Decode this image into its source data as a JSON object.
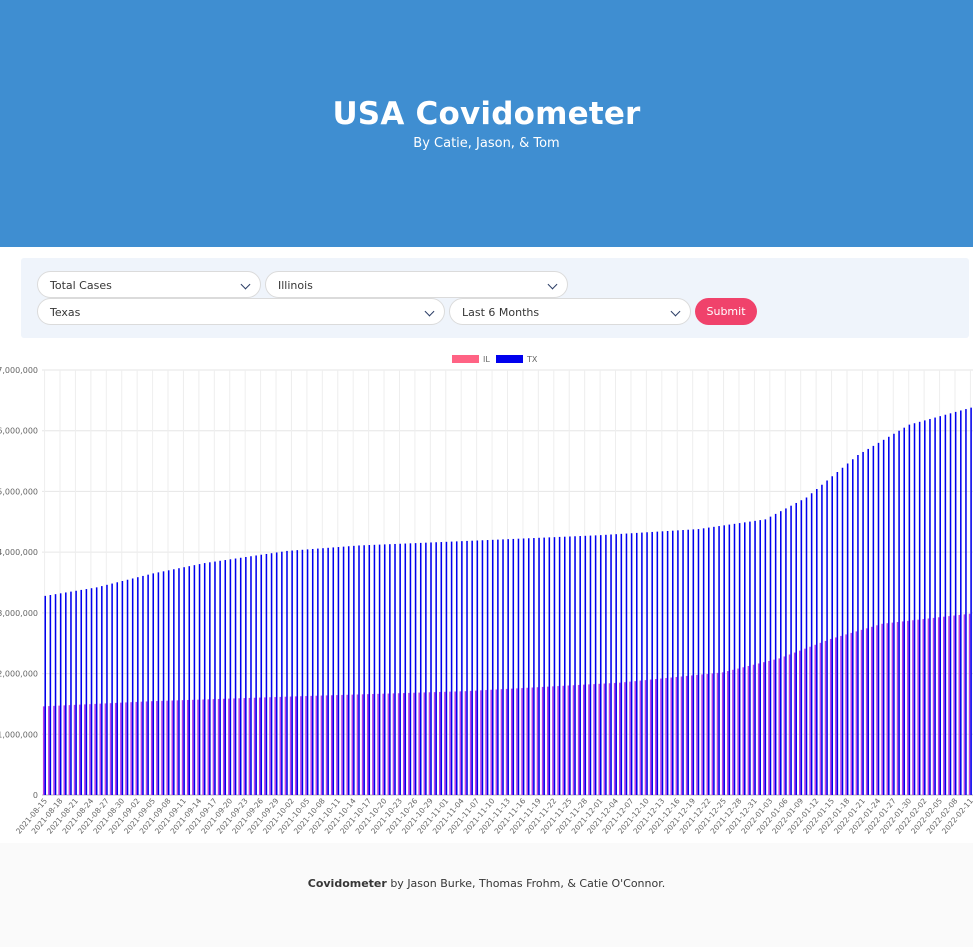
{
  "hero": {
    "title": "USA Covidometer",
    "subtitle": "By Catie, Jason, & Tom"
  },
  "controls": {
    "metric_select": "Total Cases",
    "state1_select": "Illinois",
    "state2_select": "Texas",
    "range_select": "Last 6 Months",
    "submit_label": "Submit"
  },
  "colors": {
    "hero_bg": "#3f8ed1",
    "controls_bg": "#eff4fb",
    "submit_bg": "#f0426b",
    "il_legend": "#ff6384",
    "il_bar": "#b93fe5",
    "tx_bar": "#0000ee"
  },
  "chart_data": {
    "type": "bar",
    "start_date": "2021-08-15",
    "end_date": "2022-02-11",
    "ylim": [
      0,
      7000000
    ],
    "yticks": [
      "0",
      "1,000,000",
      "2,000,000",
      "3,000,000",
      "4,000,000",
      "5,000,000",
      "6,000,000",
      "7,000,000"
    ],
    "legend_position": "top",
    "grid": true,
    "series": [
      {
        "name": "IL",
        "knots": [
          [
            "2021-08-15",
            1460000
          ],
          [
            "2021-09-05",
            1545000
          ],
          [
            "2021-10-05",
            1630000
          ],
          [
            "2021-11-05",
            1710000
          ],
          [
            "2021-12-05",
            1850000
          ],
          [
            "2021-12-25",
            2020000
          ],
          [
            "2022-01-05",
            2250000
          ],
          [
            "2022-01-15",
            2570000
          ],
          [
            "2022-01-25",
            2820000
          ],
          [
            "2022-02-11",
            2985000
          ]
        ]
      },
      {
        "name": "TX",
        "knots": [
          [
            "2021-08-15",
            3280000
          ],
          [
            "2021-08-25",
            3420000
          ],
          [
            "2021-09-05",
            3650000
          ],
          [
            "2021-09-15",
            3820000
          ],
          [
            "2021-10-01",
            4020000
          ],
          [
            "2021-10-15",
            4110000
          ],
          [
            "2021-11-01",
            4170000
          ],
          [
            "2021-12-01",
            4280000
          ],
          [
            "2021-12-20",
            4380000
          ],
          [
            "2022-01-02",
            4540000
          ],
          [
            "2022-01-10",
            4900000
          ],
          [
            "2022-01-20",
            5600000
          ],
          [
            "2022-01-30",
            6100000
          ],
          [
            "2022-02-11",
            6380000
          ]
        ]
      }
    ]
  },
  "footer": {
    "brand": "Covidometer",
    "credits": " by Jason Burke, Thomas Frohm, & Catie O'Connor."
  }
}
